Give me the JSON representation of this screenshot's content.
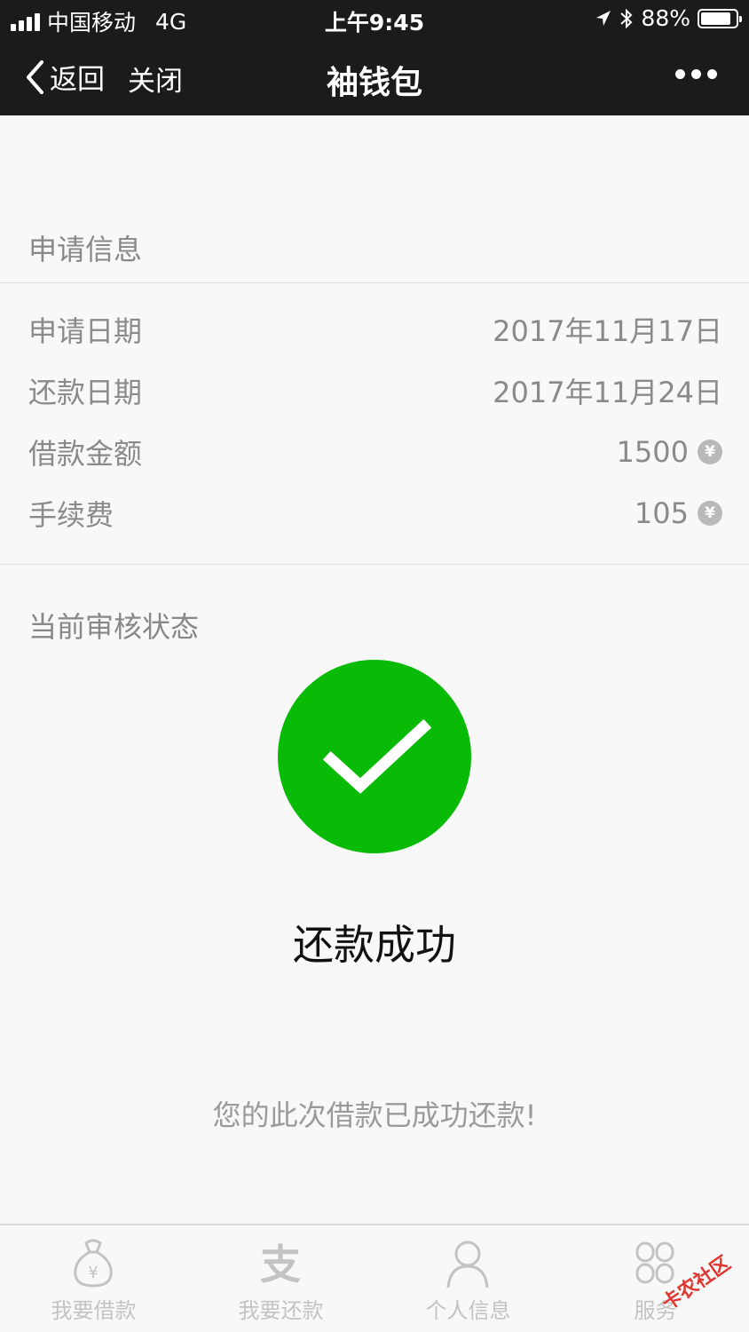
{
  "status_bar": {
    "carrier": "中国移动",
    "network": "4G",
    "time": "上午9:45",
    "battery": "88%",
    "battery_level": 0.88
  },
  "nav": {
    "back_label": "返回",
    "close_label": "关闭",
    "title": "袖钱包"
  },
  "application": {
    "section_title": "申请信息",
    "rows": [
      {
        "label": "申请日期",
        "value": "2017年11月17日"
      },
      {
        "label": "还款日期",
        "value": "2017年11月24日"
      },
      {
        "label": "借款金额",
        "value": "1500",
        "currency_icon": "¥"
      },
      {
        "label": "手续费",
        "value": "105",
        "currency_icon": "¥"
      }
    ]
  },
  "status": {
    "section_title": "当前审核状态",
    "icon": "success-check-icon",
    "icon_color": "#09bb07",
    "result_title": "还款成功",
    "result_desc": "您的此次借款已成功还款!"
  },
  "tabbar": {
    "tabs": [
      {
        "label": "我要借款",
        "icon": "money-bag-icon"
      },
      {
        "label": "我要还款",
        "icon": "alipay-icon"
      },
      {
        "label": "个人信息",
        "icon": "user-icon"
      },
      {
        "label": "服务",
        "icon": "grid-icon"
      }
    ]
  },
  "watermark": "卡农社区"
}
